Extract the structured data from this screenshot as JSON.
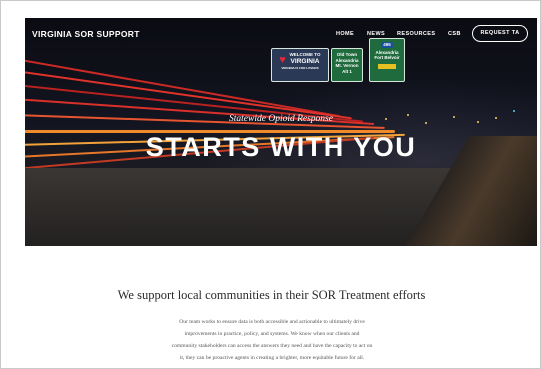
{
  "header": {
    "brand": "VIRGINIA SOR SUPPORT",
    "nav": {
      "home": "HOME",
      "news": "NEWS",
      "resources": "RESOURCES",
      "csb": "CSB"
    },
    "cta_label": "REQUEST TA"
  },
  "hero": {
    "eyebrow": "Statewide Opioid Response",
    "headline": "STARTS WITH YOU",
    "signs": {
      "welcome_1": "WELCOME TO",
      "welcome_2": "VIRGINIA",
      "welcome_3": "VIRGINIA IS FOR LOVERS",
      "sign2_1": "Old Town",
      "sign2_2": "Alexandria",
      "sign2_3": "Mt. Vernon",
      "sign2_4": "Alt 1",
      "sign3_1": "495",
      "sign3_2": "Alexandria",
      "sign3_3": "Fort Belvoir"
    }
  },
  "content": {
    "title": "We support local communities in their SOR Treatment efforts",
    "body": [
      "Our team works to ensure data is both accessible and actionable to ultimately drive",
      "improvements in practice, policy, and systems. We know when our clients and",
      "community stakeholders can access the answers they need and have the capacity to act on",
      "it, they can be proactive agents in creating a brighter, more equitable future for all."
    ]
  },
  "colors": {
    "hero_dark": "#0b0c12",
    "streak_red": "#e0332a",
    "streak_orange": "#f08a2a",
    "sign_green": "#1f6b3e",
    "heart_red": "#e3273b"
  }
}
